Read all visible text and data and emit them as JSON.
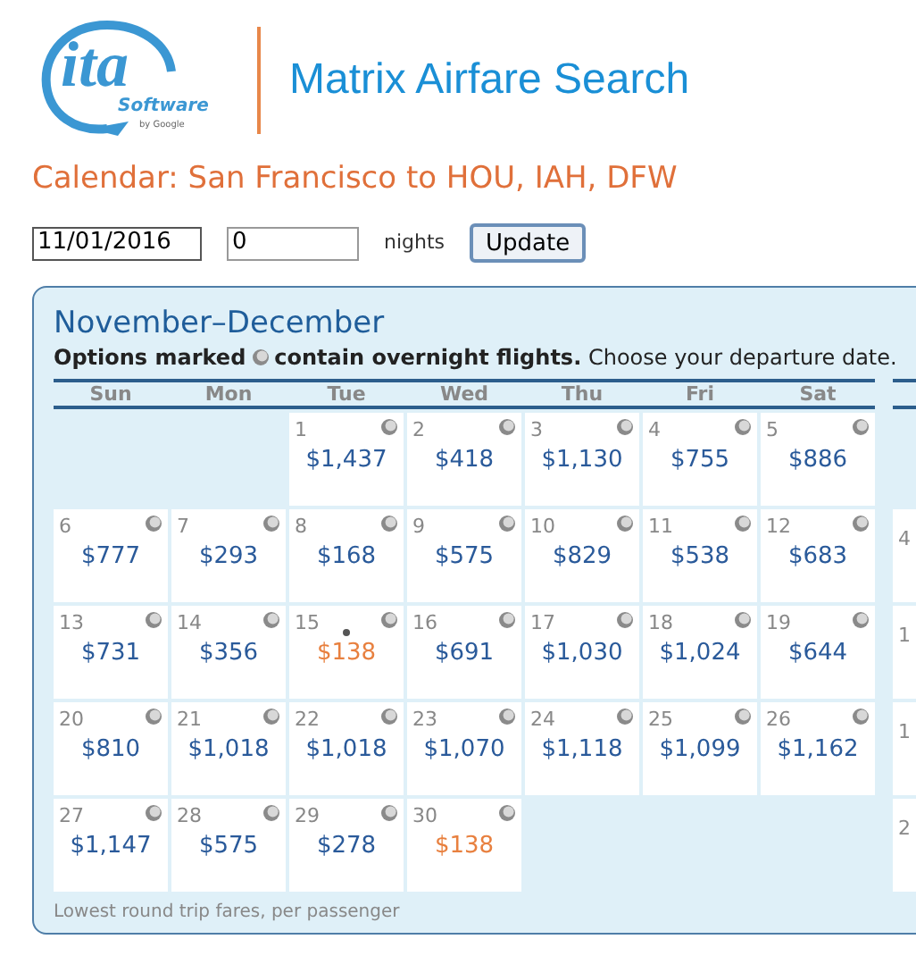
{
  "logo": {
    "mark": "ita",
    "name": "Software",
    "byline": "by Google"
  },
  "app_title": "Matrix Airfare Search",
  "heading": "Calendar: San Francisco to HOU, IAH, DFW",
  "form": {
    "date": "11/01/2016",
    "nights_value": "0",
    "nights_label": "nights",
    "button": "Update"
  },
  "calendar": {
    "title": "November–December",
    "note_label": "Options marked",
    "note_text": "**contain overnight flights.** Choose your departure date.",
    "weekdays": [
      "Sun",
      "Mon",
      "Tue",
      "Wed",
      "Thu",
      "Fri",
      "Sat"
    ],
    "weeks": [
      [
        {
          "kind": "blank"
        },
        {
          "kind": "blank"
        },
        {
          "kind": "day",
          "day": "1",
          "price": "$1,437",
          "overnight": true,
          "cheapest": false,
          "marked": false
        },
        {
          "day": "2",
          "price": "$418",
          "overnight": true,
          "cheapest": false,
          "marked": false
        },
        {
          "day": "3",
          "price": "$1,130",
          "overnight": true,
          "cheapest": false,
          "marked": false
        },
        {
          "day": "4",
          "price": "$755",
          "overnight": true,
          "cheapest": false,
          "marked": false
        },
        {
          "day": "5",
          "price": "$886",
          "overnight": true,
          "cheapest": false,
          "marked": false
        }
      ],
      [
        {
          "day": "6",
          "price": "$777",
          "overnight": true,
          "cheapest": false,
          "marked": false
        },
        {
          "day": "7",
          "price": "$293",
          "overnight": true,
          "cheapest": false,
          "marked": false
        },
        {
          "day": "8",
          "price": "$168",
          "overnight": true,
          "cheapest": false,
          "marked": false
        },
        {
          "day": "9",
          "price": "$575",
          "overnight": true,
          "cheapest": false,
          "marked": false
        },
        {
          "day": "10",
          "price": "$829",
          "overnight": true,
          "cheapest": false,
          "marked": false
        },
        {
          "day": "11",
          "price": "$538",
          "overnight": true,
          "cheapest": false,
          "marked": false
        },
        {
          "day": "12",
          "price": "$683",
          "overnight": true,
          "cheapest": false,
          "marked": false
        }
      ],
      [
        {
          "day": "13",
          "price": "$731",
          "overnight": true,
          "cheapest": false,
          "marked": false
        },
        {
          "day": "14",
          "price": "$356",
          "overnight": true,
          "cheapest": false,
          "marked": false
        },
        {
          "day": "15",
          "price": "$138",
          "overnight": true,
          "cheapest": true,
          "marked": true
        },
        {
          "day": "16",
          "price": "$691",
          "overnight": true,
          "cheapest": false,
          "marked": false
        },
        {
          "day": "17",
          "price": "$1,030",
          "overnight": true,
          "cheapest": false,
          "marked": false
        },
        {
          "day": "18",
          "price": "$1,024",
          "overnight": true,
          "cheapest": false,
          "marked": false
        },
        {
          "day": "19",
          "price": "$644",
          "overnight": true,
          "cheapest": false,
          "marked": false
        }
      ],
      [
        {
          "day": "20",
          "price": "$810",
          "overnight": true,
          "cheapest": false,
          "marked": false
        },
        {
          "day": "21",
          "price": "$1,018",
          "overnight": true,
          "cheapest": false,
          "marked": false
        },
        {
          "day": "22",
          "price": "$1,018",
          "overnight": true,
          "cheapest": false,
          "marked": false
        },
        {
          "day": "23",
          "price": "$1,070",
          "overnight": true,
          "cheapest": false,
          "marked": false
        },
        {
          "day": "24",
          "price": "$1,118",
          "overnight": true,
          "cheapest": false,
          "marked": false
        },
        {
          "day": "25",
          "price": "$1,099",
          "overnight": true,
          "cheapest": false,
          "marked": false
        },
        {
          "day": "26",
          "price": "$1,162",
          "overnight": true,
          "cheapest": false,
          "marked": false
        }
      ],
      [
        {
          "day": "27",
          "price": "$1,147",
          "overnight": true,
          "cheapest": false,
          "marked": false
        },
        {
          "day": "28",
          "price": "$575",
          "overnight": true,
          "cheapest": false,
          "marked": false
        },
        {
          "day": "29",
          "price": "$278",
          "overnight": true,
          "cheapest": false,
          "marked": false
        },
        {
          "day": "30",
          "price": "$138",
          "overnight": true,
          "cheapest": true,
          "marked": false
        },
        {
          "kind": "blank"
        },
        {
          "kind": "blank"
        },
        {
          "kind": "blank"
        }
      ]
    ],
    "footer": "Lowest round trip fares, per passenger",
    "next_month_days": [
      {
        "kind": "blank"
      },
      {
        "kind": "day",
        "day": "4"
      },
      {
        "kind": "day",
        "day": "1"
      },
      {
        "kind": "day",
        "day": "1"
      },
      {
        "kind": "day",
        "day": "2"
      }
    ]
  }
}
